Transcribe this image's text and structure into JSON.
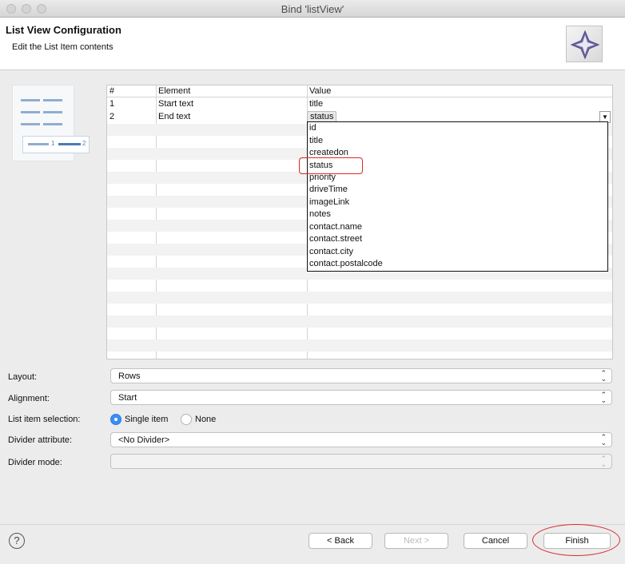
{
  "window": {
    "title": "Bind 'listView'"
  },
  "header": {
    "title": "List View Configuration",
    "subtitle": "Edit the List Item contents"
  },
  "preview": {
    "num1": "1",
    "num2": "2"
  },
  "table": {
    "headers": [
      "#",
      "Element",
      "Value"
    ],
    "rows": [
      {
        "num": "1",
        "element": "Start text",
        "value": "title"
      },
      {
        "num": "2",
        "element": "End text",
        "value": "status"
      }
    ],
    "dropdown_arrow": "▼"
  },
  "dropdown_options": [
    "id",
    "title",
    "createdon",
    "status",
    "priority",
    "driveTime",
    "imageLink",
    "notes",
    "contact.name",
    "contact.street",
    "contact.city",
    "contact.postalcode"
  ],
  "form": {
    "layout_label": "Layout:",
    "layout_value": "Rows",
    "alignment_label": "Alignment:",
    "alignment_value": "Start",
    "selection_label": "List item selection:",
    "selection_option1": "Single item",
    "selection_option2": "None",
    "divider_attr_label": "Divider attribute:",
    "divider_attr_value": "<No Divider>",
    "divider_mode_label": "Divider mode:",
    "divider_mode_value": ""
  },
  "buttons": {
    "help": "?",
    "back": "< Back",
    "next": "Next >",
    "cancel": "Cancel",
    "finish": "Finish"
  },
  "colors": {
    "accent": "#3b8cf5",
    "highlight": "#d92b2b"
  }
}
